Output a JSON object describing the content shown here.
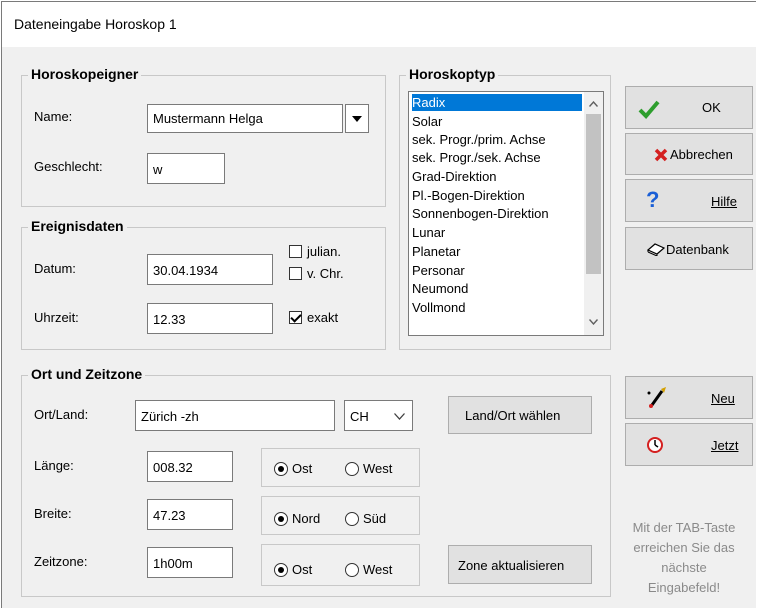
{
  "window": {
    "title": "Dateneingabe Horoskop 1"
  },
  "owner": {
    "legend": "Horoskopeigner",
    "name_label": "Name:",
    "name_value": "Mustermann Helga",
    "gender_label": "Geschlecht:",
    "gender_value": "w"
  },
  "event": {
    "legend": "Ereignisdaten",
    "date_label": "Datum:",
    "date_value": "30.04.1934",
    "julian_label": "julian.",
    "julian_checked": false,
    "bc_label": "v. Chr.",
    "bc_checked": false,
    "time_label": "Uhrzeit:",
    "time_value": "12.33",
    "exact_label": "exakt",
    "exact_checked": true
  },
  "type": {
    "legend": "Horoskoptyp",
    "items": [
      "Radix",
      "Solar",
      "sek. Progr./prim. Achse",
      "sek. Progr./sek. Achse",
      "Grad-Direktion",
      "Pl.-Bogen-Direktion",
      "Sonnenbogen-Direktion",
      "Lunar",
      "Planetar",
      "Personar",
      "Neumond",
      "Vollmond"
    ],
    "selected": "Radix"
  },
  "buttons": {
    "ok": "OK",
    "cancel": "Abbrechen",
    "help": "Hilfe",
    "db": "Datenbank",
    "new": "Neu",
    "now": "Jetzt",
    "choose_location": "Land/Ort wählen",
    "update_zone": "Zone aktualisieren"
  },
  "location": {
    "legend": "Ort und Zeitzone",
    "place_label": "Ort/Land:",
    "place_value": "Zürich -zh",
    "country_value": "CH",
    "longitude_label": "Länge:",
    "longitude_value": "008.32",
    "east_label": "Ost",
    "west_label": "West",
    "latitude_label": "Breite:",
    "latitude_value": "47.23",
    "north_label": "Nord",
    "south_label": "Süd",
    "zone_label": "Zeitzone:",
    "zone_value": "1h00m",
    "zone_east_label": "Ost",
    "zone_west_label": "West"
  },
  "hint": {
    "line1": "Mit der TAB-Taste",
    "line2": "erreichen Sie das",
    "line3": "nächste",
    "line4": "Eingabefeld!"
  },
  "colors": {
    "selection": "#0078d7",
    "ok_check": "#2e9e2e",
    "cancel_x": "#d42020",
    "help_q": "#1a5fd6"
  }
}
